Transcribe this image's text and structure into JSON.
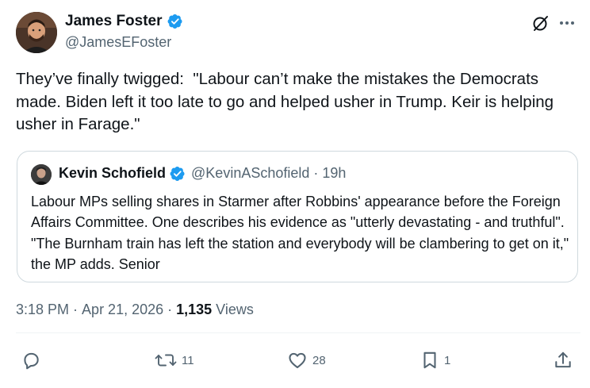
{
  "author": {
    "name": "James Foster",
    "handle": "@JamesEFoster"
  },
  "tweet": {
    "text": "They’ve finally twigged:  \"Labour can’t make the mistakes the Democrats made. Biden left it too late to go and helped usher in Trump. Keir is helping usher in Farage.\""
  },
  "quote": {
    "name": "Kevin Schofield",
    "handle": "@KevinASchofield",
    "separator": "·",
    "time": "19h",
    "text": "Labour MPs selling shares in Starmer after Robbins' appearance before the Foreign Affairs Committee. One describes his evidence as \"utterly devastating - and truthful\". \"The Burnham train has left the station and everybody will be clambering to get on it,\" the MP adds. Senior"
  },
  "meta": {
    "time": "3:18 PM",
    "sep1": " · ",
    "date": "Apr 21, 2026",
    "sep2": " · ",
    "views_count": "1,135",
    "views_label": " Views"
  },
  "actions": {
    "reply_count": "",
    "retweet_count": "11",
    "like_count": "28",
    "bookmark_count": "1"
  },
  "icons": {
    "verified": "verified-badge-icon",
    "grok": "grok-icon",
    "more": "more-icon",
    "reply": "reply-icon",
    "retweet": "retweet-icon",
    "like": "heart-icon",
    "bookmark": "bookmark-icon",
    "share": "share-icon"
  },
  "colors": {
    "text": "#0f1419",
    "secondary": "#536471",
    "verified": "#1d9bf0",
    "border": "#cfd9de"
  }
}
